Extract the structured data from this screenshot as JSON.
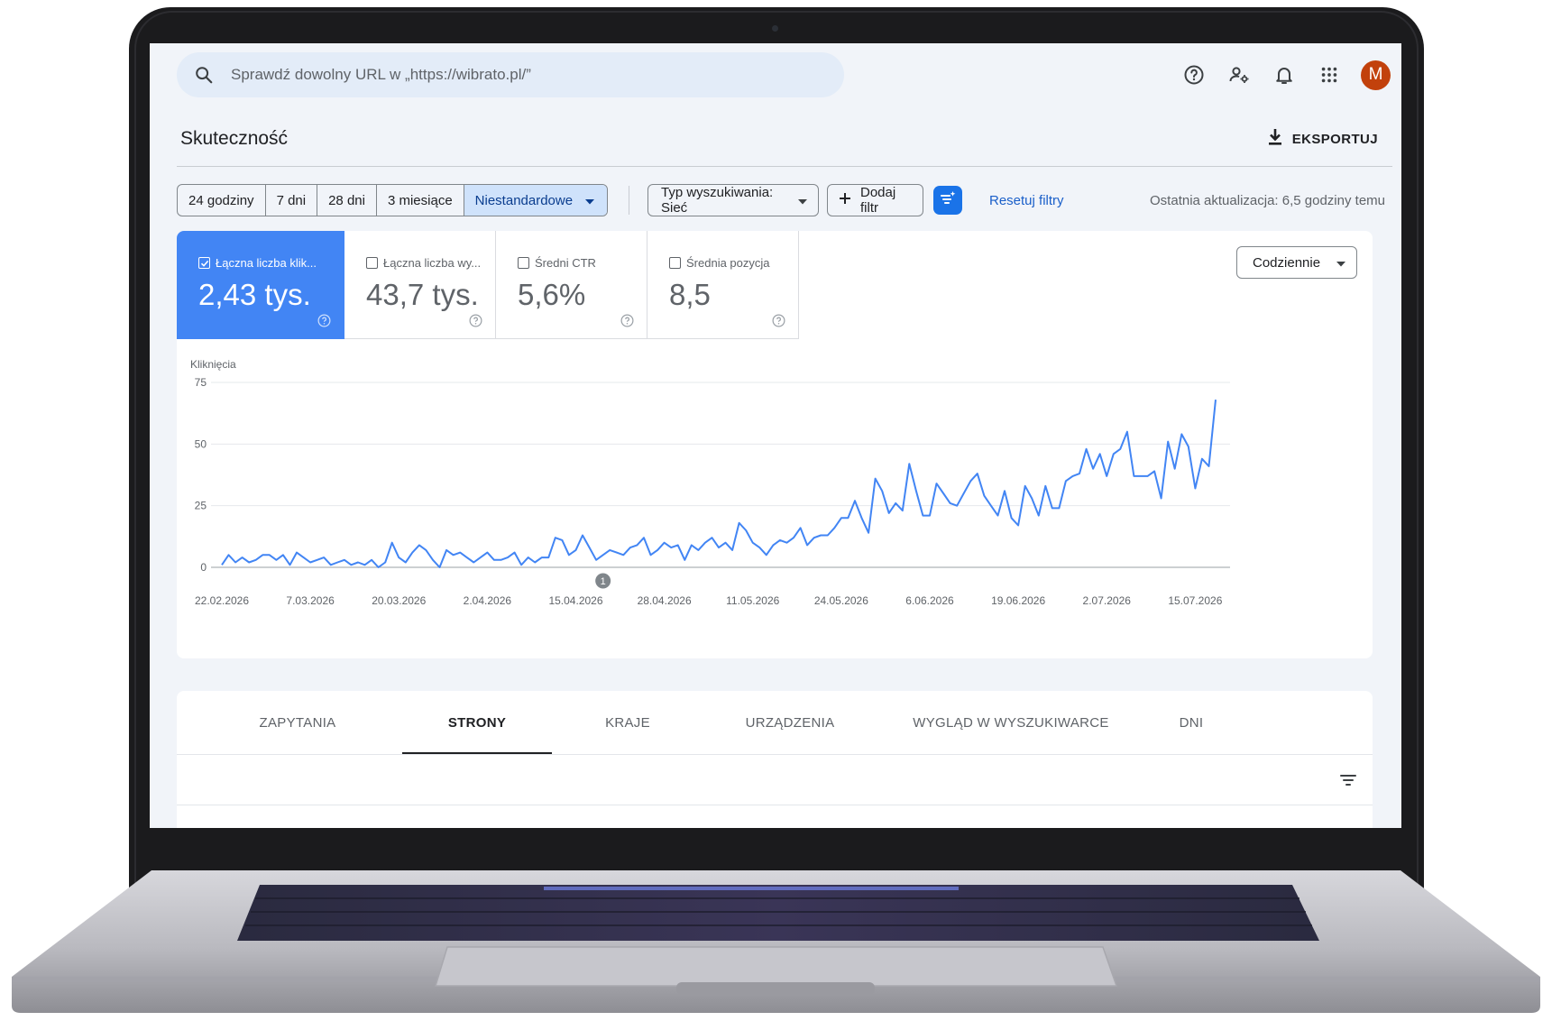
{
  "topbar": {
    "search_placeholder": "Sprawdź dowolny URL w „https://wibrato.pl/”",
    "icons": [
      "search-icon",
      "help-icon",
      "manage-users-icon",
      "bell-icon",
      "apps-grid-icon"
    ],
    "avatar_letter": "M",
    "avatar_color": "#c2410c"
  },
  "header": {
    "title": "Skuteczność",
    "export_label": "EKSPORTUJ"
  },
  "filters": {
    "date_ranges": [
      "24 godziny",
      "7 dni",
      "28 dni",
      "3 miesiące",
      "Niestandardowe"
    ],
    "active_range": "Niestandardowe",
    "search_type": "Typ wyszukiwania: Sieć",
    "add_filter": "Dodaj filtr",
    "reset": "Resetuj filtry",
    "last_update": "Ostatnia aktualizacja: 6,5 godziny temu"
  },
  "metrics": [
    {
      "label": "Łączna liczba klik...",
      "value": "2,43 tys.",
      "checked": true
    },
    {
      "label": "Łączna liczba wy...",
      "value": "43,7 tys.",
      "checked": false
    },
    {
      "label": "Średni CTR",
      "value": "5,6%",
      "checked": false
    },
    {
      "label": "Średnia pozycja",
      "value": "8,5",
      "checked": false
    }
  ],
  "granularity": "Codziennie",
  "accent_color": "#4285f4",
  "chart_data": {
    "type": "line",
    "ylabel": "Kliknięcia",
    "ylim": [
      0,
      75
    ],
    "yticks": [
      0,
      25,
      50,
      75
    ],
    "xticks": [
      "22.02.2026",
      "7.03.2026",
      "20.03.2026",
      "2.04.2026",
      "15.04.2026",
      "28.04.2026",
      "11.05.2026",
      "24.05.2026",
      "6.06.2026",
      "19.06.2026",
      "2.07.2026",
      "15.07.2026"
    ],
    "annotation": {
      "label": "1",
      "x": "19.04.2026"
    },
    "grid": true,
    "series": [
      {
        "x_start": "22.02.2026",
        "interval": "daily",
        "values": [
          1,
          5,
          2,
          4,
          2,
          3,
          5,
          5,
          3,
          5,
          1,
          6,
          4,
          2,
          3,
          4,
          1,
          2,
          3,
          1,
          2,
          1,
          3,
          0,
          2,
          10,
          4,
          2,
          6,
          9,
          7,
          3,
          0,
          7,
          5,
          6,
          4,
          2,
          4,
          6,
          3,
          3,
          4,
          6,
          1,
          4,
          2,
          4,
          4,
          12,
          11,
          5,
          7,
          13,
          8,
          3,
          5,
          7,
          6,
          5,
          8,
          9,
          12,
          5,
          7,
          10,
          8,
          9,
          3,
          9,
          7,
          10,
          12,
          8,
          10,
          7,
          18,
          15,
          10,
          8,
          5,
          9,
          11,
          10,
          12,
          16,
          9,
          12,
          13,
          13,
          16,
          20,
          20,
          27,
          20,
          14,
          36,
          31,
          22,
          26,
          23,
          42,
          31,
          21,
          21,
          34,
          30,
          26,
          25,
          30,
          35,
          38,
          29,
          25,
          21,
          31,
          20,
          17,
          33,
          28,
          21,
          33,
          24,
          24,
          35,
          37,
          38,
          48,
          40,
          46,
          37,
          46,
          48,
          55,
          37,
          37,
          37,
          39,
          28,
          51,
          40,
          54,
          49,
          32,
          44,
          41,
          68
        ]
      }
    ]
  },
  "tabs": {
    "items": [
      "ZAPYTANIA",
      "STRONY",
      "KRAJE",
      "URZĄDZENIA",
      "WYGLĄD W WYSZUKIWARCE",
      "DNI"
    ],
    "active": "STRONY"
  }
}
